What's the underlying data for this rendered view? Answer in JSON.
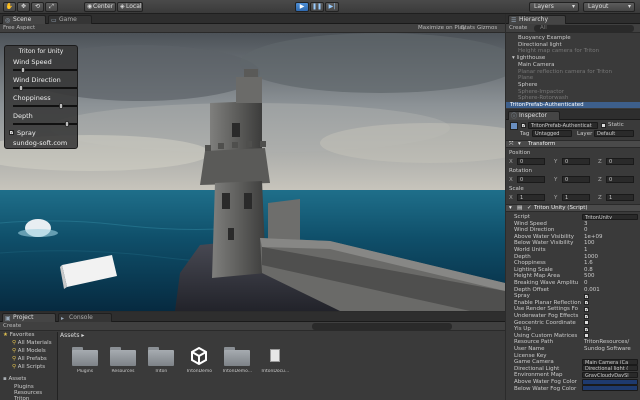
{
  "toolbar": {
    "pivot": "Center",
    "space": "Local",
    "layers": "Layers",
    "layout": "Layout"
  },
  "scene": {
    "tabs": [
      "Scene",
      "Game"
    ],
    "free_aspect": "Free Aspect",
    "maximize_on_play": "Maximize on Play",
    "stats": "Stats",
    "gizmos": "Gizmos"
  },
  "overlay": {
    "title": "Triton for Unity",
    "wind_speed_label": "Wind Speed",
    "wind_speed_level": 0.12,
    "wind_direction_label": "Wind Direction",
    "wind_direction_level": 0.08,
    "choppiness_label": "Choppiness",
    "choppiness_level": 0.75,
    "depth_label": "Depth",
    "depth_level": 0.85,
    "spray_label": "Spray",
    "spray_checked": true,
    "website": "sundog-soft.com"
  },
  "hierarchy": {
    "tab": "Hierarchy",
    "create": "Create",
    "search_placeholder": "All",
    "items": [
      {
        "label": "Buoyancy Example",
        "style": "normal",
        "indent": 0
      },
      {
        "label": "Directional light",
        "style": "normal",
        "indent": 0
      },
      {
        "label": "Height map camera for Triton",
        "style": "dim",
        "indent": 0
      },
      {
        "label": "▾ lighthouse",
        "style": "normal",
        "indent": -6
      },
      {
        "label": "Main Camera",
        "style": "normal",
        "indent": 0
      },
      {
        "label": "Planar reflection camera for Triton",
        "style": "dim",
        "indent": 0
      },
      {
        "label": "Plane",
        "style": "dim",
        "indent": 0
      },
      {
        "label": "Sphere",
        "style": "normal",
        "indent": 0
      },
      {
        "label": "Sphere-Impactor",
        "style": "dim",
        "indent": 0
      },
      {
        "label": "Sphere-Rotorwash",
        "style": "dim",
        "indent": 0
      },
      {
        "label": "TritonPrefab-Authenticated",
        "style": "sel",
        "indent": 0
      }
    ]
  },
  "inspector": {
    "tab": "Inspector",
    "object_name": "TritonPrefab-Authenticat",
    "static_label": "Static",
    "tag_label": "Tag",
    "tag_value": "Untagged",
    "layer_label": "Layer",
    "layer_value": "Default",
    "transform_title": "Transform",
    "position_label": "Position",
    "rotation_label": "Rotation",
    "scale_label": "Scale",
    "position": [
      "0",
      "0",
      "0"
    ],
    "rotation": [
      "0",
      "0",
      "0"
    ],
    "scale": [
      "1",
      "1",
      "1"
    ],
    "script_title": "Triton Unity (Script)",
    "props": [
      {
        "label": "Script",
        "value": "TritonUnity",
        "kind": "box"
      },
      {
        "label": "Wind Speed",
        "value": "3",
        "kind": "text"
      },
      {
        "label": "Wind Direction",
        "value": "0",
        "kind": "text"
      },
      {
        "label": "Above Water Visibility",
        "value": "1e+09",
        "kind": "text"
      },
      {
        "label": "Below Water Visibility",
        "value": "100",
        "kind": "text"
      },
      {
        "label": "World Units",
        "value": "1",
        "kind": "text"
      },
      {
        "label": "Depth",
        "value": "1000",
        "kind": "text"
      },
      {
        "label": "Choppiness",
        "value": "1.6",
        "kind": "text"
      },
      {
        "label": "Lighting Scale",
        "value": "0.8",
        "kind": "text"
      },
      {
        "label": "Height Map Area",
        "value": "500",
        "kind": "text"
      },
      {
        "label": "Breaking Wave Amplitu",
        "value": "0",
        "kind": "text"
      },
      {
        "label": "Depth Offset",
        "value": "0.001",
        "kind": "text"
      },
      {
        "label": "Spray",
        "value": "✓",
        "kind": "check"
      },
      {
        "label": "Enable Planar Reflection",
        "value": "✓",
        "kind": "check"
      },
      {
        "label": "Use Render Settings Fo",
        "value": "✓",
        "kind": "check"
      },
      {
        "label": "Underwater Fog Effects",
        "value": "✓",
        "kind": "check"
      },
      {
        "label": "Geocentric Coordinate",
        "value": "",
        "kind": "check"
      },
      {
        "label": "Yis Up",
        "value": "✓",
        "kind": "check"
      },
      {
        "label": "Using Custom Matrices",
        "value": "",
        "kind": "check"
      },
      {
        "label": "Resource Path",
        "value": "TritonResources/",
        "kind": "text"
      },
      {
        "label": "User Name",
        "value": "Sundog Software",
        "kind": "text"
      },
      {
        "label": "License Key",
        "value": "",
        "kind": "text"
      },
      {
        "label": "Game Camera",
        "value": "Main Camera (Ca",
        "kind": "box"
      },
      {
        "label": "Directional Light",
        "value": "Directional light (",
        "kind": "box"
      },
      {
        "label": "Environment Map",
        "value": "GrayCloudyDaySl",
        "kind": "box"
      },
      {
        "label": "Above Water Fog Color",
        "value": "",
        "kind": "color"
      },
      {
        "label": "Below Water Fog Color",
        "value": "",
        "kind": "color"
      }
    ]
  },
  "project": {
    "tabs": [
      "Project",
      "Console"
    ],
    "create": "Create",
    "favorites_label": "Favorites",
    "favorites": [
      "All Materials",
      "All Models",
      "All Prefabs",
      "All Scripts"
    ],
    "assets_label": "Assets",
    "tree": [
      "Plugins",
      "Resources",
      "Triton"
    ],
    "breadcrumb": "Assets ▸",
    "items": [
      {
        "label": "Plugins",
        "icon": "folder-icon"
      },
      {
        "label": "Resources",
        "icon": "folder-icon"
      },
      {
        "label": "Triton",
        "icon": "folder-icon"
      },
      {
        "label": "TritonDemo",
        "icon": "unity-scene-icon"
      },
      {
        "label": "TritonDemo...",
        "icon": "folder-icon"
      },
      {
        "label": "TritonDocu...",
        "icon": "document-icon"
      }
    ]
  },
  "colors": {
    "selection": "#3d5f8c",
    "play_blue": "#2f6ab0",
    "panel": "#3a3a3a",
    "fog_color": "#1e3a6e"
  }
}
